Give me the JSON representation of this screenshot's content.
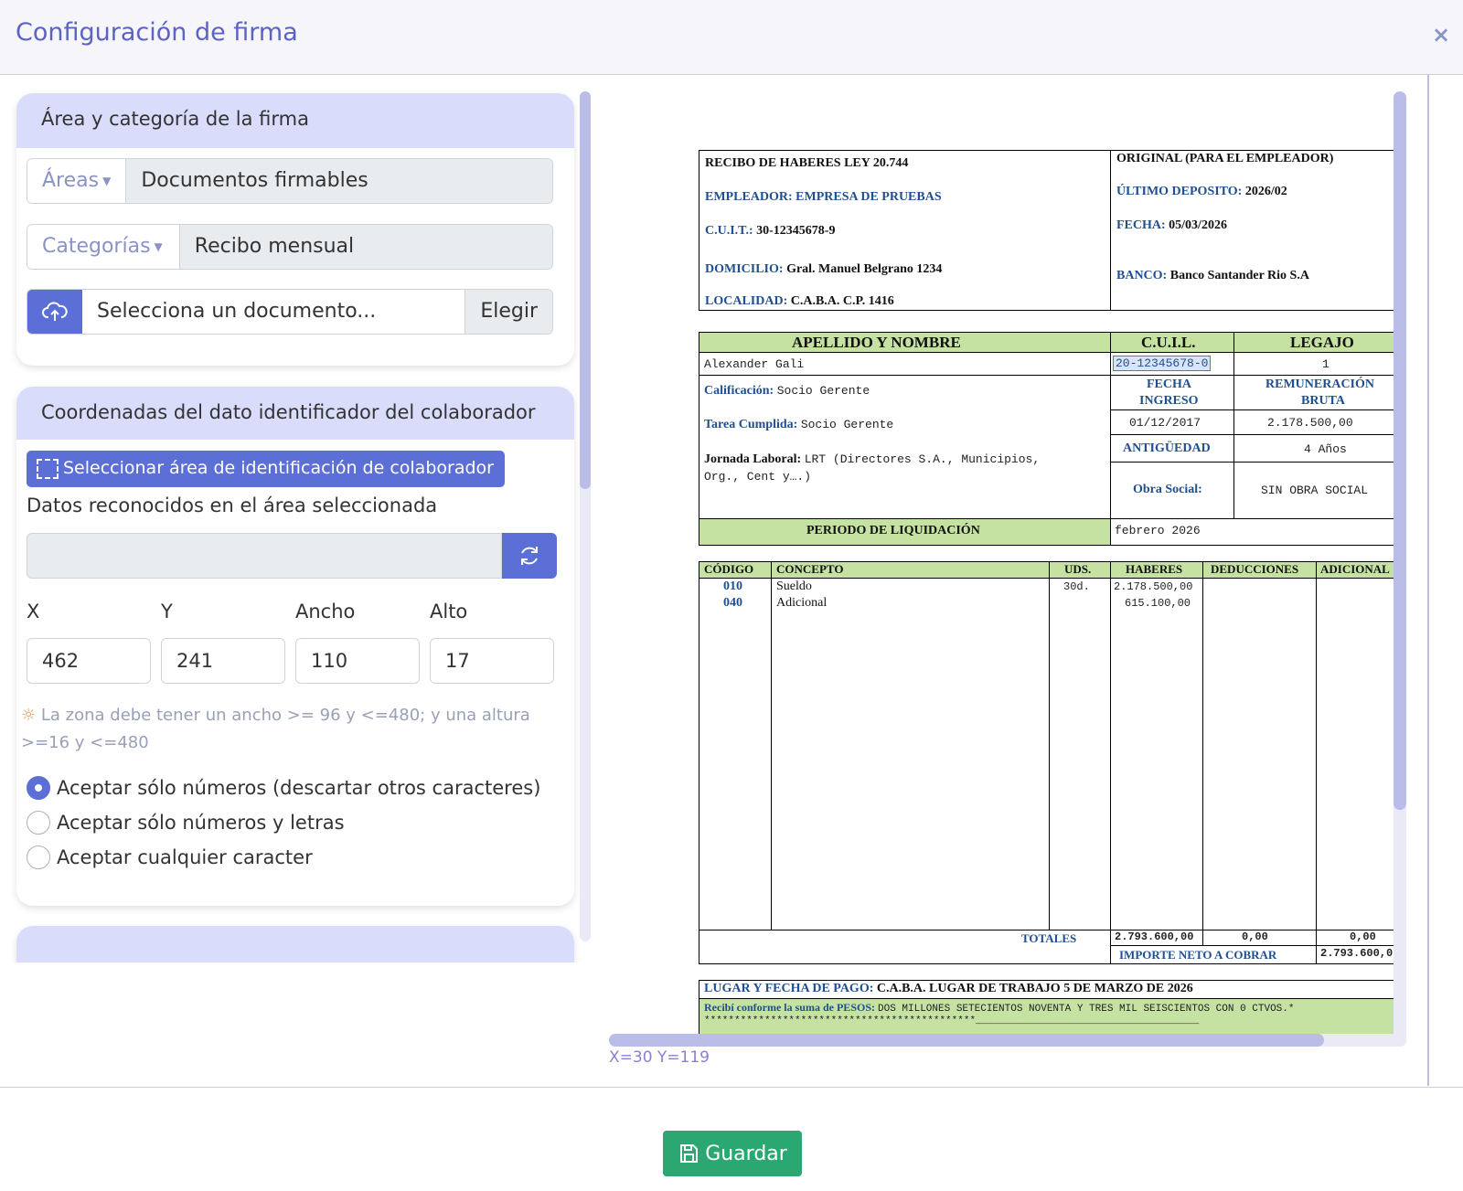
{
  "modal": {
    "title": "Configuración de firma",
    "close": "×"
  },
  "area_card": {
    "heading": "Área y categoría de la firma",
    "areas_btn": "Áreas",
    "areas_value": "Documentos firmables",
    "categorias_btn": "Categorías",
    "categorias_value": "Recibo mensual",
    "file_placeholder": "Selecciona un documento...",
    "choose_label": "Elegir"
  },
  "coord_card": {
    "heading": "Coordenadas del dato identificador del colaborador",
    "select_btn": "Seleccionar área de identificación de colaborador",
    "recognized_label": "Datos reconocidos en el área seleccionada",
    "recognized_value": "",
    "fields": {
      "x_label": "X",
      "y_label": "Y",
      "w_label": "Ancho",
      "h_label": "Alto",
      "x": "462",
      "y": "241",
      "w": "110",
      "h": "17"
    },
    "hint": "La zona debe tener un ancho >= 96 y <=480; y una altura >=16 y <=480",
    "options": [
      "Aceptar sólo números (descartar otros caracteres)",
      "Aceptar sólo números y letras",
      "Aceptar cualquier caracter"
    ],
    "selected_option": 0
  },
  "viewer": {
    "coords": "X=30 Y=119"
  },
  "doc": {
    "title": "RECIBO DE HABERES LEY 20.744",
    "empleador_label": "EMPLEADOR: EMPRESA DE PRUEBAS",
    "cuit_label": "C.U.I.T.:",
    "cuit": "30-12345678-9",
    "domicilio_label": "DOMICILIO:",
    "domicilio": "Gral. Manuel Belgrano 1234",
    "localidad_label": "LOCALIDAD:",
    "localidad": "C.A.B.A. C.P. 1416",
    "original": "ORIGINAL (PARA EL EMPLEADOR)",
    "ultimo_label": "ÚLTIMO DEPOSITO:",
    "ultimo": "2026/02",
    "fecha_label": "FECHA:",
    "fecha": "05/03/2026",
    "banco_label": "BANCO:",
    "banco": "Banco Santander Rio S.A",
    "h_apellido": "APELLIDO Y NOMBRE",
    "h_cuil": "C.U.I.L.",
    "h_legajo": "LEGAJO",
    "nombre": "Alexander Gali",
    "cuil": "20-12345678-0",
    "legajo": "1",
    "calif_label": "Calificación:",
    "calif": "Socio Gerente",
    "tarea_label": "Tarea Cumplida:",
    "tarea": "Socio Gerente",
    "jornada_label": "Jornada Laboral:",
    "jornada": "LRT (Directores S.A., Municipios,",
    "jornada2": "Org., Cent y….)",
    "h_fecha_ingreso_1": "FECHA",
    "h_fecha_ingreso_2": "INGRESO",
    "h_remun_1": "REMUNERACIÓN",
    "h_remun_2": "BRUTA",
    "fecha_ingreso": "01/12/2017",
    "remuneracion": "2.178.500,00",
    "h_antiguedad": "ANTIGÜEDAD",
    "antiguedad": "4 Años",
    "obra_label": "Obra Social:",
    "obra": "SIN OBRA SOCIAL",
    "periodo_label": "PERIODO DE LIQUIDACIÓN",
    "periodo": "febrero  2026",
    "cols": [
      "CÓDIGO",
      "CONCEPTO",
      "UDS.",
      "HABERES",
      "DEDUCCIONES",
      "ADICIONAL"
    ],
    "rows": [
      {
        "codigo": "010",
        "concepto": "Sueldo",
        "uds": "30d.",
        "haberes": "2.178.500,00"
      },
      {
        "codigo": "040",
        "concepto": "Adicional",
        "uds": "",
        "haberes": "615.100,00"
      }
    ],
    "totales_label": "TOTALES",
    "tot_haberes": "2.793.600,00",
    "tot_deducciones": "0,00",
    "tot_adicional": "0,00",
    "neto_label": "IMPORTE NETO A COBRAR",
    "neto": "2.793.600,0",
    "lugar_label": "LUGAR Y FECHA DE PAGO:",
    "lugar": "C.A.B.A. LUGAR DE TRABAJO 5 DE MARZO DE 2026",
    "recibi_label": "Recibí conforme la suma de PESOS:",
    "recibi": "DOS MILLONES SETECIENTOS NOVENTA Y TRES MIL SEISCIENTOS CON 0 CTVOS.*",
    "stars": "*********************************************_____________________________________"
  },
  "footer": {
    "save": "Guardar"
  },
  "colors": {
    "accent": "#5b6fd6",
    "card_head": "#d9dcfb",
    "save": "#2ba872",
    "doc_green": "#c5e2a3"
  }
}
